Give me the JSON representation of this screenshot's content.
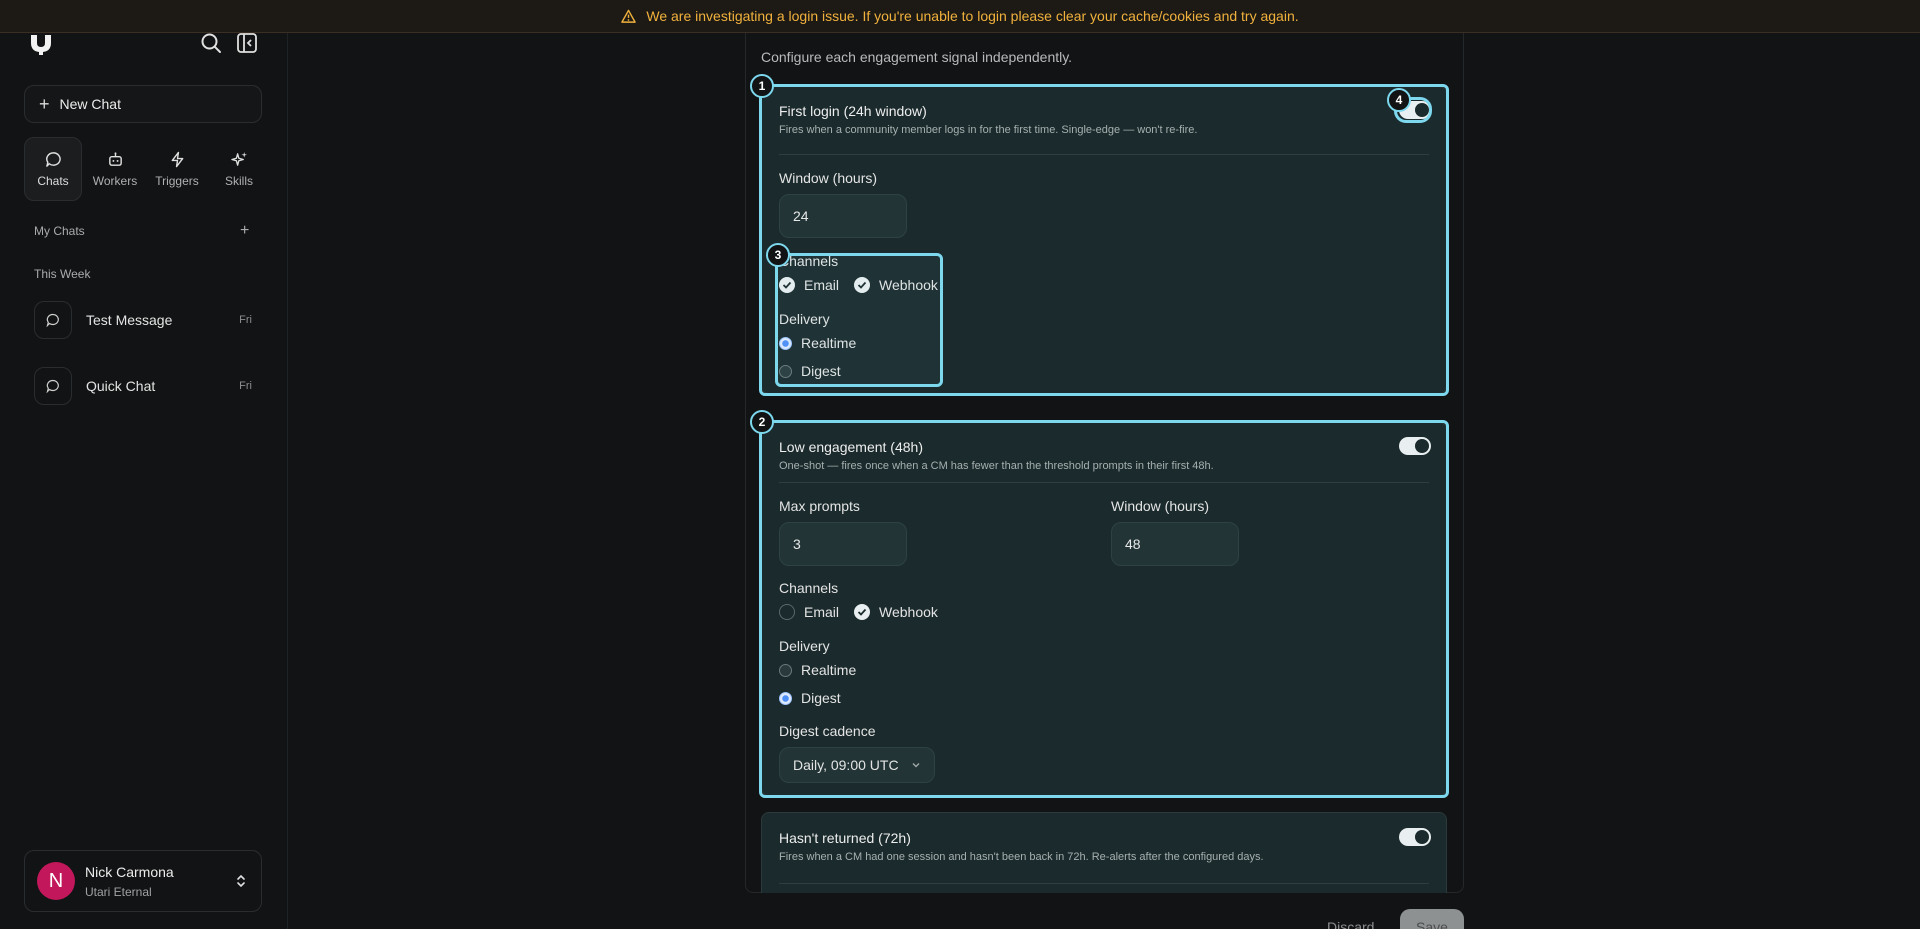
{
  "banner": {
    "message": "We are investigating a login issue. If you're unable to login please clear your cache/cookies and try again."
  },
  "sidebar": {
    "new_chat_label": "New Chat",
    "tabs": [
      {
        "label": "Chats",
        "icon": "chat-bubble-icon",
        "active": true
      },
      {
        "label": "Workers",
        "icon": "robot-icon",
        "active": false
      },
      {
        "label": "Triggers",
        "icon": "lightning-icon",
        "active": false
      },
      {
        "label": "Skills",
        "icon": "sparkles-icon",
        "active": false
      }
    ],
    "my_chats_label": "My Chats",
    "this_week_label": "This Week",
    "chats": [
      {
        "title": "Test Message",
        "day": "Fri"
      },
      {
        "title": "Quick Chat",
        "day": "Fri"
      }
    ],
    "user": {
      "initial": "N",
      "name": "Nick Carmona",
      "org": "Utari Eternal"
    }
  },
  "main": {
    "subtitle": "Configure each engagement signal independently.",
    "cards": [
      {
        "title": "First login (24h window)",
        "description": "Fires when a community member logs in for the first time. Single-edge — won't re-fire.",
        "window_label": "Window (hours)",
        "window_value": "24",
        "channels_label": "Channels",
        "channel_email": "Email",
        "channel_webhook": "Webhook",
        "delivery_label": "Delivery",
        "delivery_realtime": "Realtime",
        "delivery_digest": "Digest",
        "enabled": true
      },
      {
        "title": "Low engagement (48h)",
        "description": "One-shot — fires once when a CM has fewer than the threshold prompts in their first 48h.",
        "max_prompts_label": "Max prompts",
        "max_prompts_value": "3",
        "window_label": "Window (hours)",
        "window_value": "48",
        "channels_label": "Channels",
        "channel_email": "Email",
        "channel_webhook": "Webhook",
        "delivery_label": "Delivery",
        "delivery_realtime": "Realtime",
        "delivery_digest": "Digest",
        "cadence_label": "Digest cadence",
        "cadence_value": "Daily, 09:00 UTC",
        "enabled": true
      },
      {
        "title": "Hasn't returned (72h)",
        "description": "Fires when a CM had one session and hasn't been back in 72h. Re-alerts after the configured days.",
        "enabled": true
      }
    ],
    "discard_label": "Discard",
    "save_label": "Save"
  },
  "annotations": [
    "1",
    "2",
    "3",
    "4"
  ],
  "colors": {
    "accent_highlight": "#7dd8ee",
    "banner_text": "#f0b13c",
    "card_bg": "#1b2a2c",
    "avatar": "#c2185b"
  }
}
